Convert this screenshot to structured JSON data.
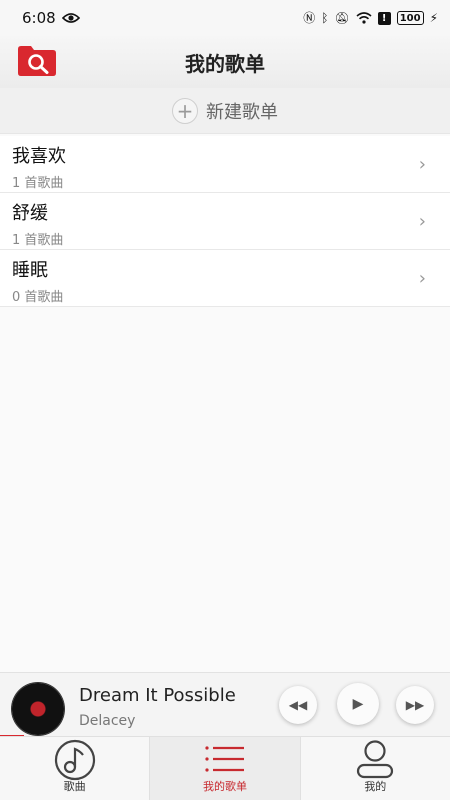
{
  "status_bar": {
    "time": "6:08",
    "battery": "100",
    "icons": [
      "eye-icon",
      "nfc-icon",
      "bluetooth-icon",
      "mute-icon",
      "wifi-icon",
      "alert-icon",
      "battery-icon",
      "charging-icon"
    ]
  },
  "header": {
    "title": "我的歌单",
    "logo_icon": "folder-search-icon"
  },
  "new_playlist": {
    "label": "新建歌单",
    "icon": "plus-icon"
  },
  "playlists": [
    {
      "name": "我喜欢",
      "count": "1 首歌曲"
    },
    {
      "name": "舒缓",
      "count": "1 首歌曲"
    },
    {
      "name": "睡眠",
      "count": "0 首歌曲"
    }
  ],
  "player": {
    "title": "Dream It Possible",
    "artist": "Delacey",
    "controls": [
      "rewind-icon",
      "play-icon",
      "fast-forward-icon"
    ]
  },
  "nav": {
    "items": [
      {
        "label": "歌曲",
        "icon": "music-note-icon"
      },
      {
        "label": "我的歌单",
        "icon": "list-icon"
      },
      {
        "label": "我的",
        "icon": "person-icon"
      }
    ],
    "active_index": 1
  },
  "colors": {
    "accent": "#d9282f",
    "background": "#fafafa"
  }
}
